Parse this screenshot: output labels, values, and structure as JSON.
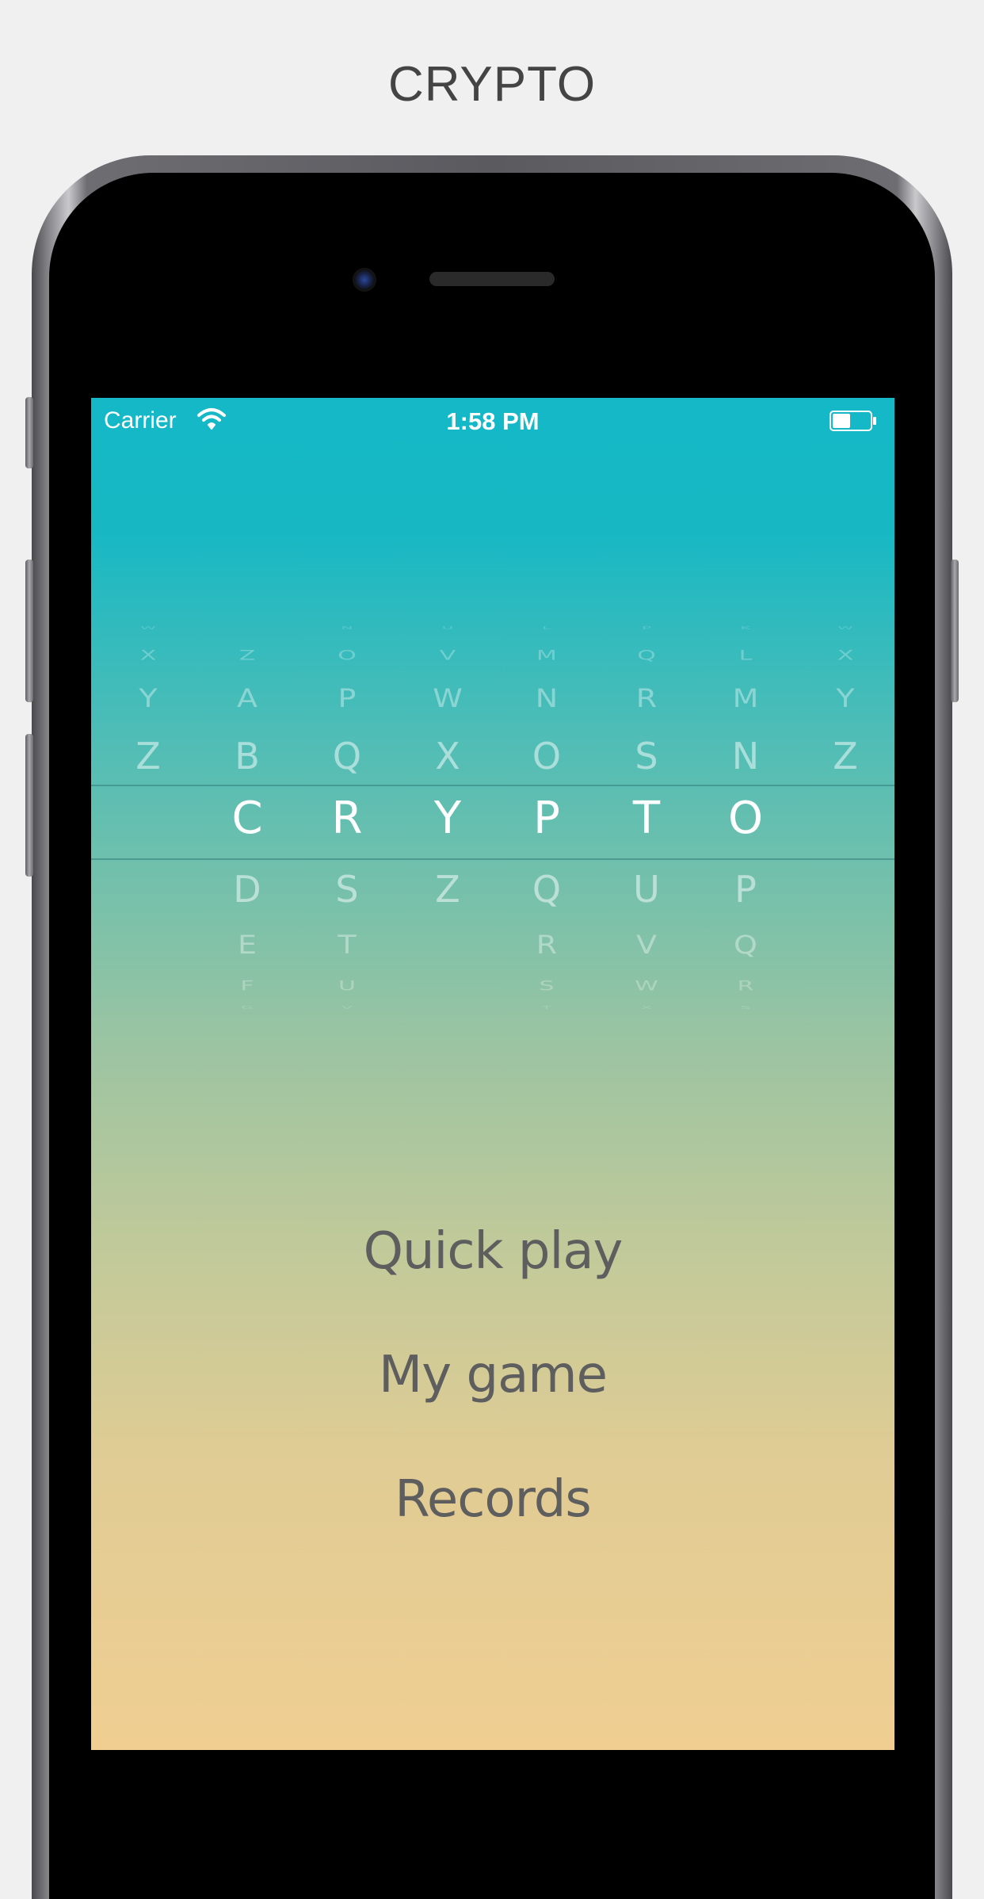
{
  "page_title": "CRYPTO",
  "status_bar": {
    "carrier": "Carrier",
    "time": "1:58 PM",
    "wifi_icon": "wifi-icon",
    "battery_icon": "battery-icon"
  },
  "wheel": {
    "selected_word": "CRYPTO",
    "columns": [
      {
        "letters": [
          "W",
          "X",
          "Y",
          "Z",
          "",
          "",
          "",
          "",
          ""
        ]
      },
      {
        "letters": [
          "",
          "Z",
          "A",
          "B",
          "C",
          "D",
          "E",
          "F",
          "G"
        ]
      },
      {
        "letters": [
          "N",
          "O",
          "P",
          "Q",
          "R",
          "S",
          "T",
          "U",
          "V"
        ]
      },
      {
        "letters": [
          "U",
          "V",
          "W",
          "X",
          "Y",
          "Z",
          "",
          "",
          ""
        ]
      },
      {
        "letters": [
          "L",
          "M",
          "N",
          "O",
          "P",
          "Q",
          "R",
          "S",
          "T"
        ]
      },
      {
        "letters": [
          "P",
          "Q",
          "R",
          "S",
          "T",
          "U",
          "V",
          "W",
          "X"
        ]
      },
      {
        "letters": [
          "K",
          "L",
          "M",
          "N",
          "O",
          "P",
          "Q",
          "R",
          "S"
        ]
      },
      {
        "letters": [
          "W",
          "X",
          "Y",
          "Z",
          "",
          "",
          "",
          "",
          ""
        ]
      }
    ]
  },
  "menu": {
    "quick_play": "Quick play",
    "my_game": "My game",
    "records": "Records"
  }
}
